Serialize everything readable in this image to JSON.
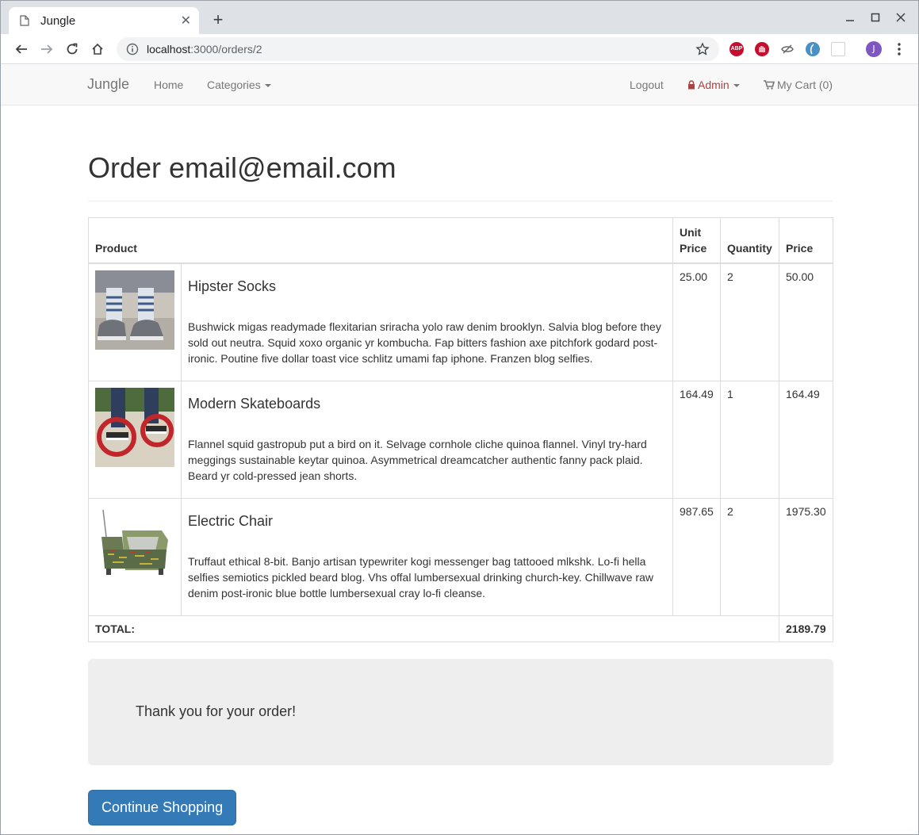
{
  "browser": {
    "tab_title": "Jungle",
    "new_tab": "+",
    "url_host": "localhost",
    "url_path": ":3000/orders/2",
    "avatar_letter": "J",
    "extensions": [
      {
        "name": "adblock-plus-icon",
        "label": "ABP",
        "color": "#c70d2c"
      },
      {
        "name": "ublock-icon",
        "color": "#c70d2c"
      },
      {
        "name": "eye-extension-icon",
        "color": "#5f6368"
      },
      {
        "name": "globe-extension-icon",
        "color": "#4a90c2"
      },
      {
        "name": "grid-extension-icon",
        "color": "#cfd2d6"
      }
    ]
  },
  "navbar": {
    "brand": "Jungle",
    "home": "Home",
    "categories": "Categories",
    "logout": "Logout",
    "admin": "Admin",
    "cart": "My Cart (0)"
  },
  "page": {
    "title": "Order email@email.com"
  },
  "table": {
    "headers": {
      "product": "Product",
      "unit_price_1": "Unit",
      "unit_price_2": "Price",
      "quantity": "Quantity",
      "price": "Price"
    },
    "rows": [
      {
        "name": "Hipster Socks",
        "description": "Bushwick migas readymade flexitarian sriracha yolo raw denim brooklyn. Salvia blog before they sold out neutra. Squid xoxo organic yr kombucha. Fap bitters fashion axe pitchfork godard post-ironic. Poutine five dollar toast vice schlitz umami fap iphone. Franzen blog selfies.",
        "unit_price": "25.00",
        "quantity": "2",
        "price": "50.00"
      },
      {
        "name": "Modern Skateboards",
        "description": "Flannel squid gastropub put a bird on it. Selvage cornhole cliche quinoa flannel. Vinyl try-hard meggings sustainable keytar quinoa. Asymmetrical dreamcatcher authentic fanny pack plaid. Beard yr cold-pressed jean shorts.",
        "unit_price": "164.49",
        "quantity": "1",
        "price": "164.49"
      },
      {
        "name": "Electric Chair",
        "description": "Truffaut ethical 8-bit. Banjo artisan typewriter kogi messenger bag tattooed mlkshk. Lo-fi hella selfies semiotics pickled beard blog. Vhs offal lumbersexual drinking church-key. Chillwave raw denim post-ironic blue bottle lumbersexual cray lo-fi cleanse.",
        "unit_price": "987.65",
        "quantity": "2",
        "price": "1975.30"
      }
    ],
    "total_label": "TOTAL:",
    "total_value": "2189.79"
  },
  "thank_you": "Thank you for your order!",
  "continue_button": "Continue Shopping",
  "colors": {
    "link": "#777777",
    "admin": "#a94442",
    "primary": "#337ab7"
  }
}
